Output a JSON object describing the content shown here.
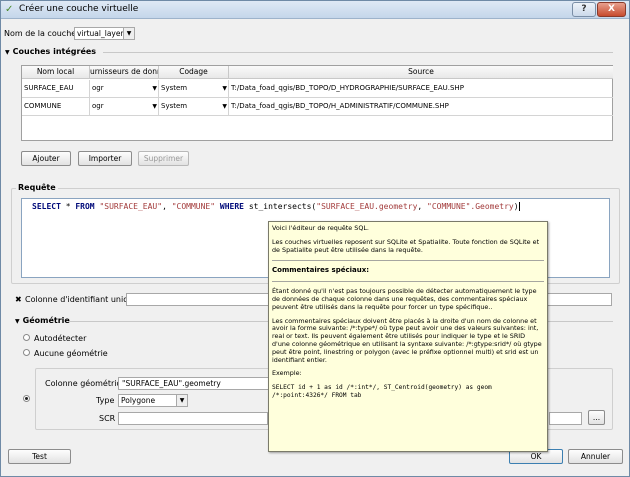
{
  "window": {
    "title": "Créer une couche virtuelle",
    "help_label": "?",
    "close_label": "X"
  },
  "layer_name": {
    "label": "Nom de la couche",
    "value": "virtual_layer"
  },
  "embedded": {
    "title": "Couches intégrées",
    "columns": [
      "Nom local",
      "urnisseurs de donne",
      "Codage",
      "Source"
    ],
    "rows": [
      {
        "name": "SURFACE_EAU",
        "provider": "ogr",
        "encoding": "System",
        "source": "T:/Data_foad_qgis/BD_TOPO/D_HYDROGRAPHIE/SURFACE_EAU.SHP"
      },
      {
        "name": "COMMUNE",
        "provider": "ogr",
        "encoding": "System",
        "source": "T:/Data_foad_qgis/BD_TOPO/H_ADMINISTRATIF/COMMUNE.SHP"
      }
    ],
    "add_label": "Ajouter",
    "import_label": "Importer",
    "delete_label": "Supprimer"
  },
  "query": {
    "title": "Requête",
    "sql": {
      "kw_select": "SELECT",
      "star": " * ",
      "kw_from": "FROM",
      "t1": "\"SURFACE_EAU\"",
      "comma": ", ",
      "t2": "\"COMMUNE\"",
      "kw_where": "WHERE",
      "func": " st_intersects(",
      "arg1": "\"SURFACE_EAU.geometry",
      "comma2": ", ",
      "arg2": "\"COMMUNE\".Geometry",
      "close": ")"
    }
  },
  "uid": {
    "label": "Colonne d'identifiant unique",
    "check": "✖"
  },
  "geometry": {
    "title": "Géométrie",
    "autodetect_label": "Autodétecter",
    "none_label": "Aucune géométrie",
    "column_label": "Colonne géométrique",
    "column_value": "\"SURFACE_EAU\".geometry",
    "type_label": "Type",
    "type_value": "Polygone",
    "srid_label": "SCR",
    "srid_button": "..."
  },
  "footer": {
    "test_label": "Test",
    "ok_label": "OK",
    "cancel_label": "Annuler"
  },
  "tooltip": {
    "p1": "Voici l'éditeur de requête SQL.",
    "p2": "Les couches virtuelles reposent sur SQLite et Spatialite. Toute fonction de SQLite et de Spatialite peut être utilisée dans la requête.",
    "heading": "Commentaires spéciaux:",
    "p3": "Étant donné qu'il n'est pas toujours possible de détecter automatiquement le type de données de chaque colonne dans une requêtes, des commentaires spéciaux peuvent être utilisés dans la requête pour forcer un type spécifique..",
    "p4": "Les commentaires spéciaux doivent être placés à la droite d'un nom de colonne et avoir la forme suivante: /*:type*/ où type peut avoir une des valeurs suivantes: int, real or text. Ils peuvent également être utilisés pour indiquer le type et le SRID d'une colonne géométrique en utilisant la syntaxe suivante: /*:gtype:srid*/ où gtype peut être point, linestring or polygon (avec le préfixe optionnel multi) et srid est un identifiant entier.",
    "example_label": "Exemple:",
    "example_code": "SELECT id + 1 as id /*:int*/, ST_Centroid(geometry) as geom /*:point:4326*/ FROM tab"
  },
  "colors": {
    "keyword": "#000a7a",
    "string": "#a33c3c",
    "tooltip_bg": "#ffffdc"
  }
}
